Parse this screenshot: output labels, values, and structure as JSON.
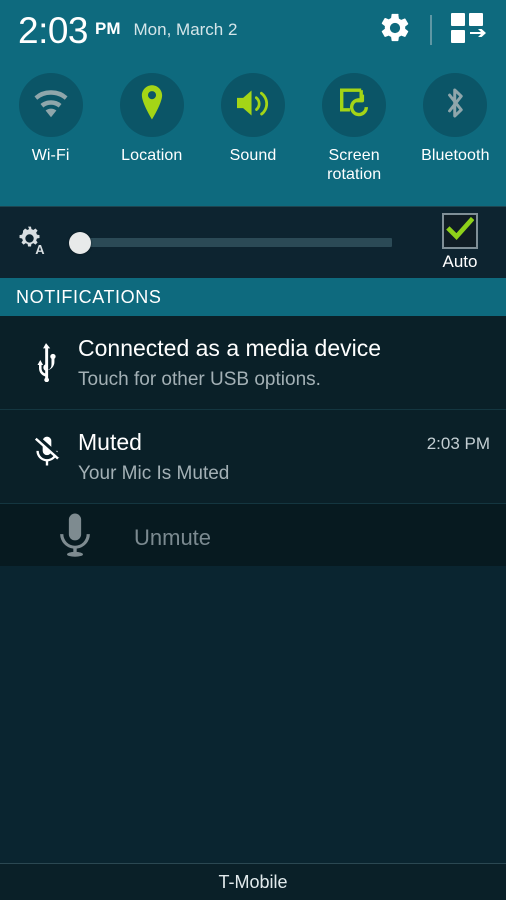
{
  "statusbar": {
    "time": "2:03",
    "ampm": "PM",
    "date": "Mon, March 2",
    "settings_icon": "gear-icon",
    "quick_panel_icon": "quick-settings-grid-icon"
  },
  "quick_toggles": [
    {
      "label": "Wi-Fi",
      "icon": "wifi-icon",
      "state": "off",
      "color": "#8fa6ab"
    },
    {
      "label": "Location",
      "icon": "location-pin-icon",
      "state": "on",
      "color": "#a4d516"
    },
    {
      "label": "Sound",
      "icon": "speaker-sound-icon",
      "state": "on",
      "color": "#a4d516"
    },
    {
      "label": "Screen\nrotation",
      "icon": "screen-rotation-icon",
      "state": "on",
      "color": "#a4d516"
    },
    {
      "label": "Bluetooth",
      "icon": "bluetooth-icon",
      "state": "off",
      "color": "#8fa6ab"
    }
  ],
  "quick_toggle_labels": {
    "wifi": "Wi-Fi",
    "location": "Location",
    "sound": "Sound",
    "screen_rotation_line1": "Screen",
    "screen_rotation_line2": "rotation",
    "bluetooth": "Bluetooth"
  },
  "brightness": {
    "icon": "auto-brightness-gear-icon",
    "value": 0,
    "auto_label": "Auto",
    "auto_checked": true,
    "check_icon": "checkmark-icon"
  },
  "notifications_header": "NOTIFICATIONS",
  "notifications": [
    {
      "icon": "usb-icon",
      "title": "Connected as a media device",
      "subtitle": "Touch for other USB options.",
      "time": ""
    },
    {
      "icon": "microphone-muted-icon",
      "title": "Muted",
      "subtitle": "Your Mic Is Muted",
      "time": "2:03 PM"
    }
  ],
  "notification_action": {
    "icon": "microphone-icon",
    "label": "Unmute"
  },
  "carrier": "T-Mobile",
  "colors": {
    "header_teal": "#0e6a7e",
    "toggle_circle": "#0b5567",
    "accent_green": "#a4d516",
    "panel_dark": "#0a2028",
    "brightness_bar": "#0d2430",
    "inactive_grey": "#8fa6ab"
  }
}
